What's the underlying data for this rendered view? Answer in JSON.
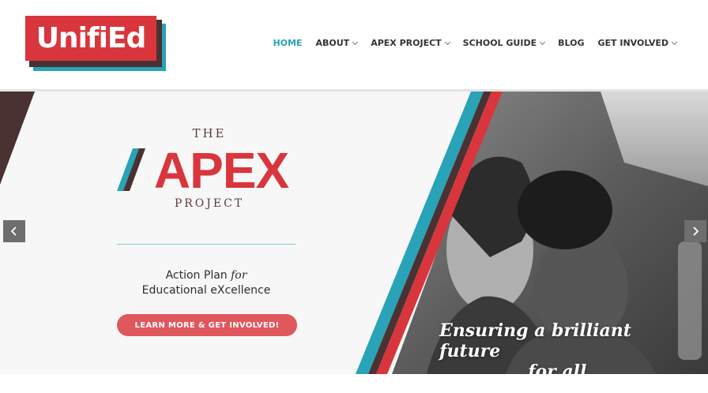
{
  "header": {
    "logo_text": "UnifiEd",
    "nav": [
      {
        "label": "HOME",
        "active": true,
        "has_dropdown": false
      },
      {
        "label": "ABOUT",
        "active": false,
        "has_dropdown": true
      },
      {
        "label": "APEX PROJECT",
        "active": false,
        "has_dropdown": true
      },
      {
        "label": "SCHOOL GUIDE",
        "active": false,
        "has_dropdown": true
      },
      {
        "label": "BLOG",
        "active": false,
        "has_dropdown": false
      },
      {
        "label": "GET INVOLVED",
        "active": false,
        "has_dropdown": true
      }
    ]
  },
  "hero": {
    "the_label": "THE",
    "apex_label": "APEX",
    "project_label": "PROJECT",
    "tagline_line1_a": "Action Plan ",
    "tagline_line1_for": "for",
    "tagline_line2": "Educational eXcellence",
    "cta_label": "LEARN MORE & GET INVOLVED!",
    "caption_line1": "Ensuring a brilliant future",
    "caption_line2": "for all",
    "prev_icon": "chevron-left-icon",
    "next_icon": "chevron-right-icon"
  },
  "colors": {
    "brand_red": "#d9353d",
    "brand_teal": "#29a3b8",
    "brand_maroon": "#4a3232",
    "cta_red": "#e0575d",
    "nav_active": "#2aa0b8"
  }
}
